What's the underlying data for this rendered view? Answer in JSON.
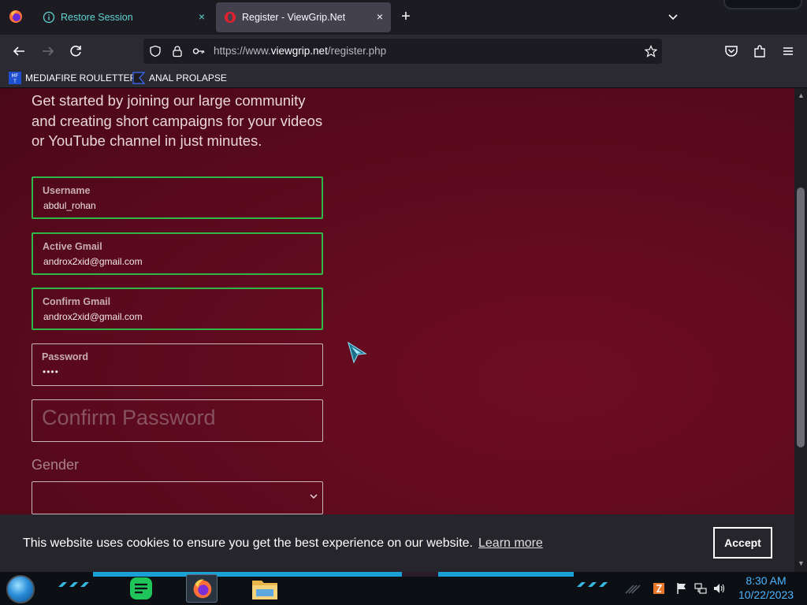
{
  "browser": {
    "tabs": [
      {
        "label": "Restore Session",
        "close": "×"
      },
      {
        "label": "Register - ViewGrip.Net",
        "close": "×"
      }
    ],
    "new_tab": "+",
    "url": {
      "scheme": "https://www.",
      "domain": "viewgrip.net",
      "path": "/register.php"
    },
    "bookmarks": [
      {
        "label": "MEDIAFIRE ROULETTER",
        "icon_text": "MF\nT"
      },
      {
        "label": "ANAL PROLAPSE"
      }
    ]
  },
  "page": {
    "intro": "Get started by joining our large community and creating short campaigns for your videos or YouTube channel in just minutes.",
    "fields": {
      "username": {
        "label": "Username",
        "value": "abdul_rohan"
      },
      "gmail": {
        "label": "Active Gmail",
        "value": "androx2xid@gmail.com"
      },
      "confirm_gmail": {
        "label": "Confirm Gmail",
        "value": "androx2xid@gmail.com"
      },
      "password": {
        "label": "Password",
        "value": "••••"
      },
      "confirm_password": {
        "placeholder": "Confirm Password"
      }
    },
    "gender": {
      "label": "Gender",
      "value": ""
    }
  },
  "cookie": {
    "message": "This website uses cookies to ensure you get the best experience on our website.",
    "learn_more": "Learn more",
    "accept": "Accept"
  },
  "taskbar": {
    "time": "8:30 AM",
    "date": "10/22/2023"
  },
  "colors": {
    "page_bg": "#5c0a1d",
    "valid_border": "#2fb84a",
    "accent_clock": "#4fb4ff"
  }
}
